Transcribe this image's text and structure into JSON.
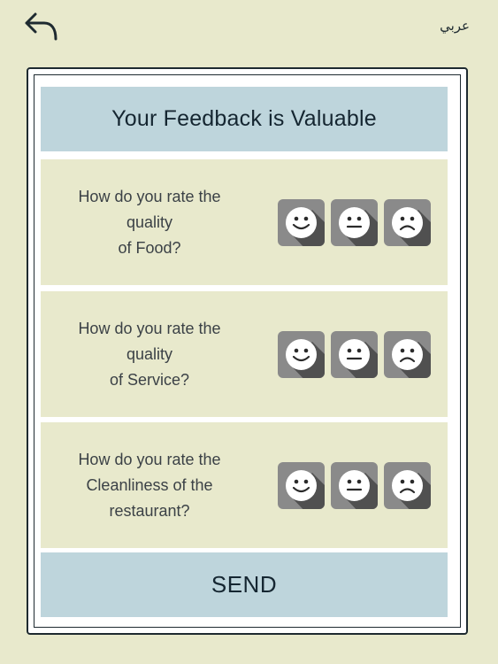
{
  "top_bar": {
    "language_label": "عربي"
  },
  "form": {
    "title": "Your Feedback is Valuable",
    "questions": [
      {
        "text": "How do you rate the quality\nof Food?"
      },
      {
        "text": "How do you rate the quality\nof Service?"
      },
      {
        "text": "How do you rate the\nCleanliness of the\nrestaurant?"
      }
    ],
    "send_label": "SEND"
  },
  "icons": {
    "back": "back-arrow-icon",
    "ratings": [
      "smiley-happy-icon",
      "smiley-neutral-icon",
      "smiley-sad-icon"
    ]
  },
  "colors": {
    "background": "#e8e9cc",
    "band": "#bed5dc",
    "face_tile": "#8a8a8a",
    "face_shadow": "#505050",
    "text_dark": "#152631"
  }
}
